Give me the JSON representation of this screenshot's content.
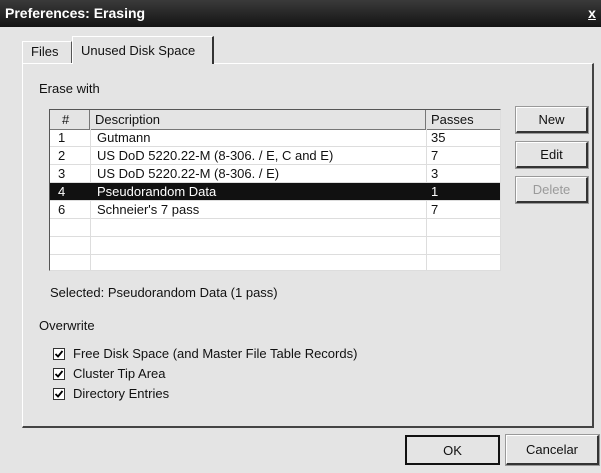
{
  "window": {
    "title": "Preferences: Erasing",
    "close_label": "x"
  },
  "tabs": [
    {
      "label": "Files",
      "active": false
    },
    {
      "label": "Unused Disk Space",
      "active": true
    }
  ],
  "erase_with_label": "Erase with",
  "list": {
    "columns": [
      "#",
      "Description",
      "Passes"
    ],
    "rows": [
      {
        "num": "1",
        "description": "Gutmann",
        "passes": "35",
        "selected": false
      },
      {
        "num": "2",
        "description": "US DoD 5220.22-M (8-306. / E, C and E)",
        "passes": "7",
        "selected": false
      },
      {
        "num": "3",
        "description": "US DoD 5220.22-M (8-306. / E)",
        "passes": "3",
        "selected": false
      },
      {
        "num": "4",
        "description": "Pseudorandom Data",
        "passes": "1",
        "selected": true
      },
      {
        "num": "6",
        "description": "Schneier's 7 pass",
        "passes": "7",
        "selected": false
      }
    ],
    "empty_rows": 3
  },
  "side_buttons": {
    "new": "New",
    "edit": "Edit",
    "delete": "Delete"
  },
  "selected_text": "Selected: Pseudorandom Data (1 pass)",
  "overwrite_label": "Overwrite",
  "checkboxes": [
    {
      "label": "Free Disk Space (and Master File Table Records)",
      "checked": true
    },
    {
      "label": "Cluster Tip Area",
      "checked": true
    },
    {
      "label": "Directory Entries",
      "checked": true
    }
  ],
  "footer": {
    "ok": "OK",
    "cancel": "Cancelar"
  }
}
